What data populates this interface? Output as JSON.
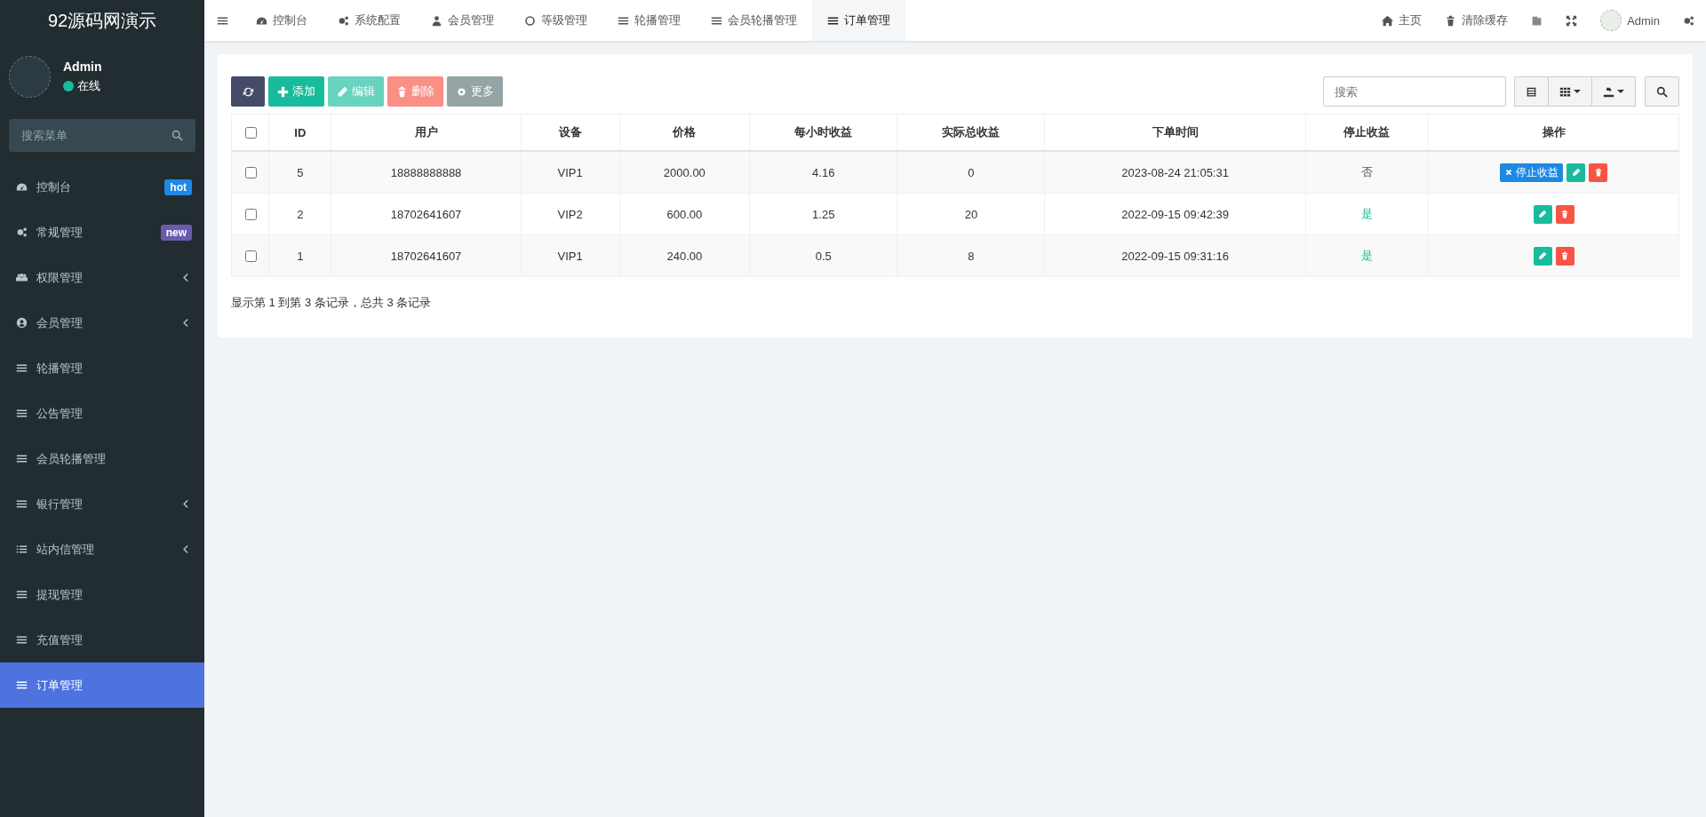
{
  "sidebar": {
    "logo": "92源码网演示",
    "user": {
      "name": "Admin",
      "status": "在线",
      "online": true
    },
    "search": {
      "placeholder": "搜索菜单"
    },
    "items": [
      {
        "label": "控制台",
        "badge": {
          "text": "hot",
          "color": "#1e88e5"
        },
        "expandable": false,
        "selected": false
      },
      {
        "label": "常规管理",
        "badge": {
          "text": "new",
          "color": "#6a5cad"
        },
        "expandable": false,
        "selected": false
      },
      {
        "label": "权限管理",
        "expandable": true,
        "selected": false
      },
      {
        "label": "会员管理",
        "expandable": true,
        "selected": false
      },
      {
        "label": "轮播管理",
        "expandable": false,
        "selected": false
      },
      {
        "label": "公告管理",
        "expandable": false,
        "selected": false
      },
      {
        "label": "会员轮播管理",
        "expandable": false,
        "selected": false
      },
      {
        "label": "银行管理",
        "expandable": true,
        "selected": false
      },
      {
        "label": "站内信管理",
        "expandable": true,
        "selected": false
      },
      {
        "label": "提现管理",
        "expandable": false,
        "selected": false
      },
      {
        "label": "充值管理",
        "expandable": false,
        "selected": false
      },
      {
        "label": "订单管理",
        "expandable": false,
        "selected": true
      }
    ]
  },
  "header": {
    "tabs": [
      {
        "label": "控制台",
        "selected": false
      },
      {
        "label": "系统配置",
        "selected": false
      },
      {
        "label": "会员管理",
        "selected": false
      },
      {
        "label": "等级管理",
        "selected": false
      },
      {
        "label": "轮播管理",
        "selected": false
      },
      {
        "label": "会员轮播管理",
        "selected": false
      },
      {
        "label": "订单管理",
        "selected": true
      }
    ],
    "links": [
      "主页",
      "清除缓存"
    ],
    "user": "Admin"
  },
  "toolbar": {
    "buttons": [
      {
        "kind": "refresh",
        "disabled": false
      },
      {
        "kind": "add",
        "label": "添加",
        "disabled": false
      },
      {
        "kind": "edit",
        "label": "编辑",
        "disabled": true
      },
      {
        "kind": "delete",
        "label": "删除",
        "disabled": true
      },
      {
        "kind": "more",
        "label": "更多",
        "disabled": false
      }
    ],
    "search": {
      "placeholder": "搜索"
    }
  },
  "table": {
    "header_checked": false,
    "columns": [
      "ID",
      "用户",
      "设备",
      "价格",
      "每小时收益",
      "实际总收益",
      "下单时间",
      "停止收益",
      "操作"
    ],
    "rows": [
      {
        "checked": false,
        "cells": [
          "5",
          "18888888888",
          "VIP1",
          "2000.00",
          "4.16",
          "0",
          "2023-08-24 21:05:31"
        ],
        "stop": {
          "text": "否",
          "stopped": false
        },
        "actions": [
          {
            "kind": "stop",
            "label": "停止收益"
          },
          {
            "kind": "edit"
          },
          {
            "kind": "delete"
          }
        ]
      },
      {
        "checked": false,
        "cells": [
          "2",
          "18702641607",
          "VIP2",
          "600.00",
          "1.25",
          "20",
          "2022-09-15 09:42:39"
        ],
        "stop": {
          "text": "是",
          "stopped": true
        },
        "actions": [
          {
            "kind": "edit"
          },
          {
            "kind": "delete"
          }
        ]
      },
      {
        "checked": false,
        "cells": [
          "1",
          "18702641607",
          "VIP1",
          "240.00",
          "0.5",
          "8",
          "2022-09-15 09:31:16"
        ],
        "stop": {
          "text": "是",
          "stopped": true
        },
        "actions": [
          {
            "kind": "edit"
          },
          {
            "kind": "delete"
          }
        ]
      }
    ],
    "summary": "显示第 1 到第 3 条记录，总共 3 条记录"
  }
}
